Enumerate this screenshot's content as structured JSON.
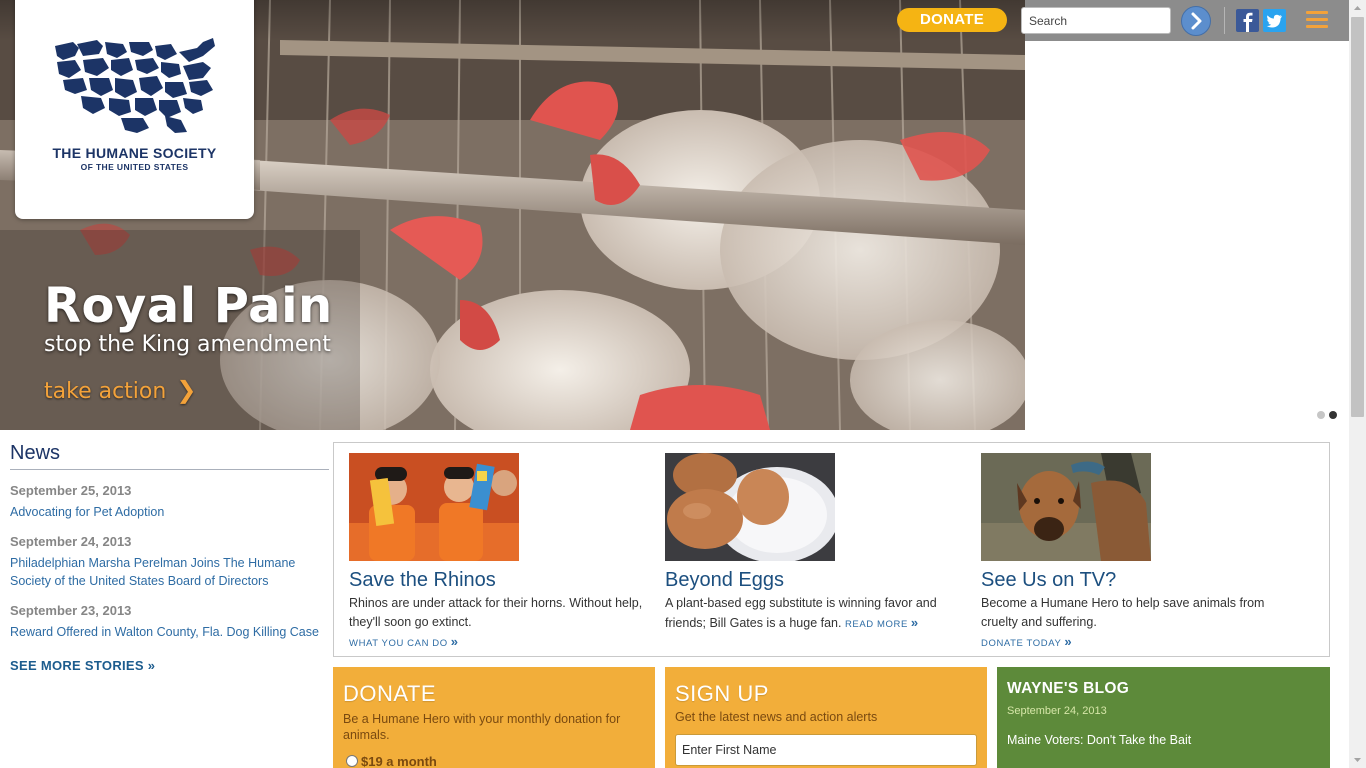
{
  "brand": {
    "logo_line1": "THE HUMANE SOCIETY",
    "logo_line2": "OF THE UNITED STATES",
    "navy": "#1c3466",
    "accent_orange": "#f3a23a"
  },
  "topbar": {
    "donate_label": "DONATE",
    "search_placeholder": "Search",
    "icons": [
      "arrow-right-icon",
      "facebook-icon",
      "twitter-icon",
      "menu-icon"
    ]
  },
  "hero": {
    "title": "Royal Pain",
    "subtitle": "stop the King amendment",
    "cta_label": "take action",
    "cta_glyph": "❯",
    "slides": 2,
    "active_slide": 2
  },
  "news": {
    "heading": "News",
    "items": [
      {
        "date": "September 25, 2013",
        "title": "Advocating for Pet Adoption"
      },
      {
        "date": "September 24, 2013",
        "title": "Philadelphian Marsha Perelman Joins The Humane Society of the United States Board of Directors"
      },
      {
        "date": "September 23, 2013",
        "title": "Reward Offered in Walton County, Fla. Dog Killing Case"
      }
    ],
    "more_label": "SEE MORE STORIES »"
  },
  "features": [
    {
      "title": "Save the Rhinos",
      "desc": "Rhinos are under attack for their horns. Without help, they'll soon go extinct.",
      "link": "WHAT YOU CAN DO",
      "glyph": "»"
    },
    {
      "title": "Beyond Eggs",
      "desc": "A plant-based egg substitute is winning favor and friends; Bill Gates is a huge fan.",
      "link": "READ MORE",
      "glyph": "»"
    },
    {
      "title": "See Us on TV?",
      "desc": "Become a Humane Hero to help save animals from cruelty and suffering.",
      "link": "DONATE TODAY",
      "glyph": "»"
    }
  ],
  "panels": {
    "donate": {
      "title": "DONATE",
      "desc": "Be a Humane Hero with your monthly donation for animals.",
      "option": "$19 a month"
    },
    "signup": {
      "title": "SIGN UP",
      "desc": "Get the latest news and action alerts",
      "placeholder": "Enter First Name"
    },
    "blog": {
      "title": "WAYNE'S BLOG",
      "date": "September 24, 2013",
      "post": "Maine Voters: Don't Take the Bait"
    }
  }
}
